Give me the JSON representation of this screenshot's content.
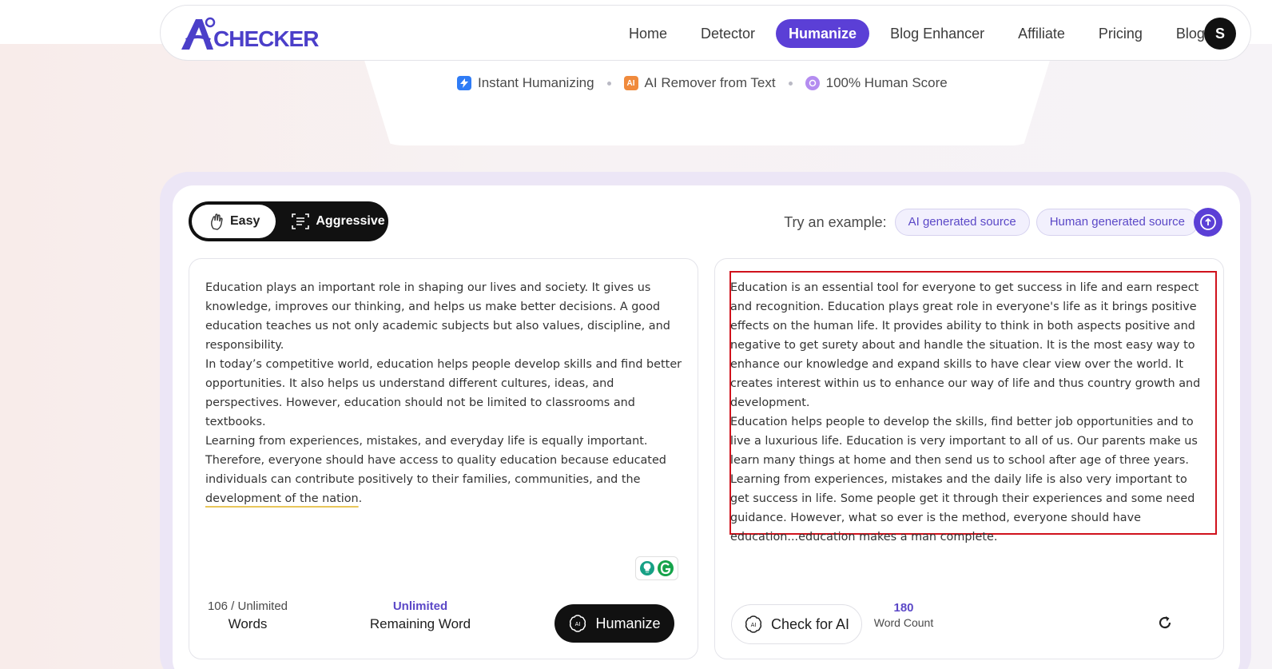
{
  "brand": {
    "logo_text": "CHECKER",
    "accent": "#5b3fd6"
  },
  "nav": {
    "items": [
      "Home",
      "Detector",
      "Humanize",
      "Blog Enhancer",
      "Affiliate",
      "Pricing",
      "Blog"
    ],
    "active": "Humanize"
  },
  "user": {
    "initial": "S"
  },
  "features": [
    {
      "icon": "lightning-icon",
      "label": "Instant Humanizing"
    },
    {
      "icon": "ai-badge-icon",
      "label": "AI Remover from Text"
    },
    {
      "icon": "brain-icon",
      "label": "100% Human Score"
    }
  ],
  "modes": {
    "easy": "Easy",
    "aggressive": "Aggressive",
    "selected": "Easy"
  },
  "examples": {
    "label": "Try an example:",
    "ai_source": "AI generated source",
    "human_source": "Human generated source"
  },
  "input": {
    "paragraphs": [
      "Education plays an important role in shaping our lives and society. It gives us knowledge, improves our thinking, and helps us make better decisions. A good education teaches us not only academic subjects but also values, discipline, and responsibility.",
      " In today’s competitive world, education helps people develop skills and find better opportunities. It also helps us understand different cultures, ideas, and perspectives. However, education should not be limited to classrooms and textbooks."
    ],
    "last_paragraph_start": " Learning from experiences, mistakes, and everyday life is equally important. Therefore, everyone should have access to quality education because educated individuals can contribute positively to their families, communities, and the ",
    "last_paragraph_flagged": "development of the nation",
    "last_paragraph_end": "."
  },
  "input_stats": {
    "words_count": "106 / Unlimited",
    "words_label": "Words",
    "remaining_value": "Unlimited",
    "remaining_label": "Remaining Word"
  },
  "humanize_button": "Humanize",
  "output": {
    "paragraphs": [
      "Education is an essential tool for everyone to get success in life and earn respect and recognition. Education plays great role in everyone's life as it brings positive effects on the human life. It provides ability to think in both aspects positive and negative to get surety about and handle the situation. It is the most easy way to enhance our knowledge and expand skills to have clear view over the world. It creates interest within us to enhance our way of life and thus country growth and development.",
      "Education helps people to develop the skills, find better job opportunities and to live a luxurious life. Education is very important to all of us. Our parents make us learn many things at home and then send us to school after age of three years.",
      "Learning from experiences, mistakes and the daily life is also very important to get success in life. Some people get it through their experiences and some need guidance. However, what so ever is the method, everyone should have education...education makes a man complete."
    ]
  },
  "output_stats": {
    "check_button": "Check for AI",
    "word_count_value": "180",
    "word_count_label": "Word Count"
  }
}
